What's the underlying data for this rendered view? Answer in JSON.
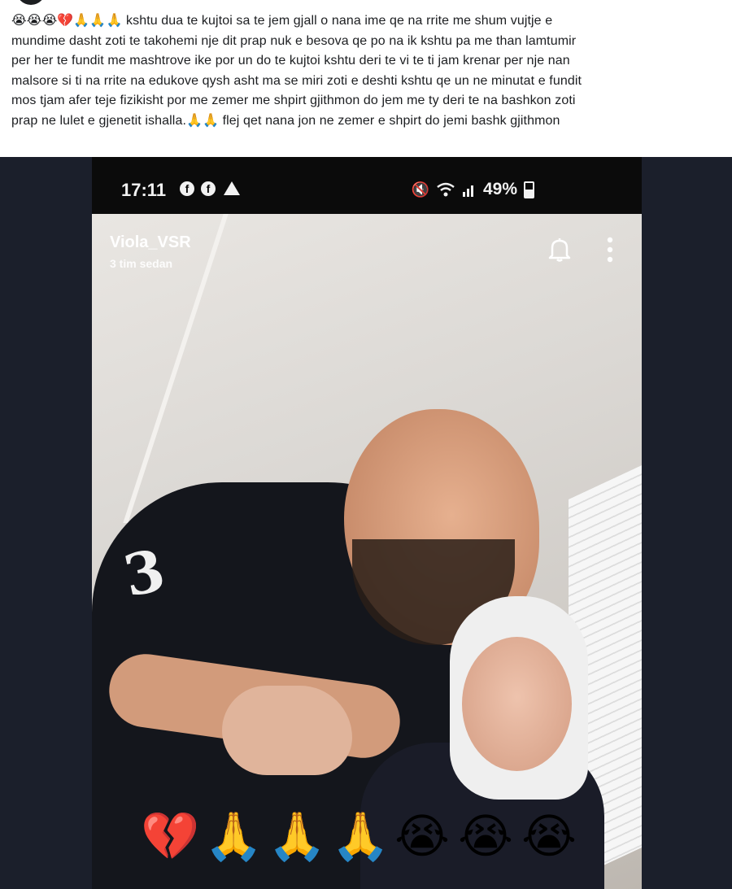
{
  "post": {
    "lines": [
      "😭😭😭💔🙏🙏🙏 kshtu dua te kujtoi sa te jem gjall o nana ime qe na rrite me shum vujtje e",
      "mundime dasht zoti te takohemi nje dit prap nuk e besova qe po na ik kshtu pa me than lamtumir",
      "per her te fundit me mashtrove ike por un do te kujtoi kshtu deri te vi te ti jam krenar per nje nan",
      "malsore si ti na rrite na edukove qysh asht ma se miri zoti e deshti kshtu qe un ne minutat e fundit",
      "mos tjam afer teje fizikisht por me zemer me shpirt gjithmon do jem me ty deri te na bashkon zoti",
      "prap ne lulet e gjenetit ishalla.🙏🙏  flej qet nana jon ne zemer e shpirt do jemi bashk gjithmon"
    ]
  },
  "phone": {
    "status": {
      "time": "17:11",
      "left_icons": [
        "facebook-icon",
        "facebook-icon",
        "warning-icon"
      ],
      "right_icons": [
        "mute-icon",
        "wifi-icon",
        "signal-icon"
      ],
      "battery": "49%",
      "battery_level": 0.49
    },
    "story": {
      "username": "Viola_VSR",
      "time_ago": "3 tim sedan",
      "icons": [
        "bell-icon",
        "more-vertical-icon"
      ],
      "reactions": [
        "💔",
        "🙏",
        "🙏",
        "🙏",
        "😭",
        "😭",
        "😭"
      ]
    }
  },
  "colors": {
    "page_bg": "#ffffff",
    "media_bg": "#1b1f2b",
    "text": "#1c1e21"
  }
}
